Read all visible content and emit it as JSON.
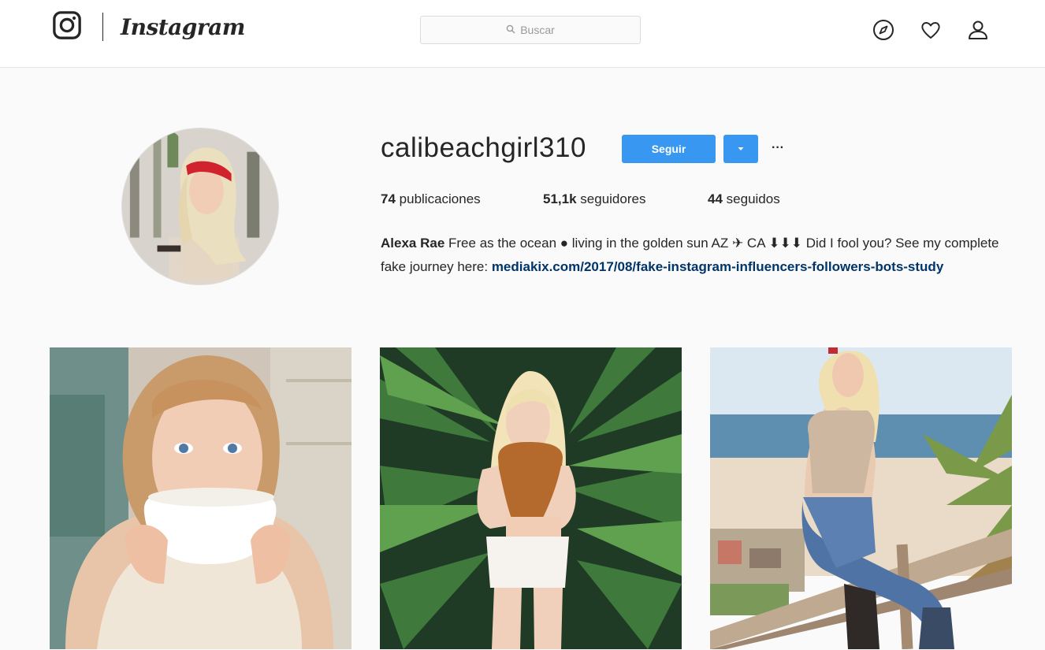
{
  "nav": {
    "wordmark": "Instagram",
    "search_placeholder": "Buscar",
    "icons": [
      "instagram-camera-icon",
      "search-icon",
      "compass-icon",
      "heart-icon",
      "person-icon"
    ]
  },
  "profile": {
    "username": "calibeachgirl310",
    "follow_label": "Seguir",
    "more_label": "···",
    "stats": {
      "posts_count": "74",
      "posts_label": "publicaciones",
      "followers_count": "51,1k",
      "followers_label": "seguidores",
      "following_count": "44",
      "following_label": "seguidos"
    },
    "bio": {
      "name": "Alexa Rae",
      "text": "Free as the ocean ● living in the golden sun AZ ✈ CA ⬇⬇⬇ Did I fool you? See my complete fake journey here: ",
      "link": "mediakix.com/2017/08/fake-instagram-influencers-followers-bots-study"
    }
  },
  "colors": {
    "accent": "#3897f0",
    "link": "#003569",
    "background": "#fafafa"
  },
  "posts": [
    {
      "scene": "woman-drinking-coffee"
    },
    {
      "scene": "woman-in-palm-leaves"
    },
    {
      "scene": "woman-on-beach-railing"
    }
  ]
}
